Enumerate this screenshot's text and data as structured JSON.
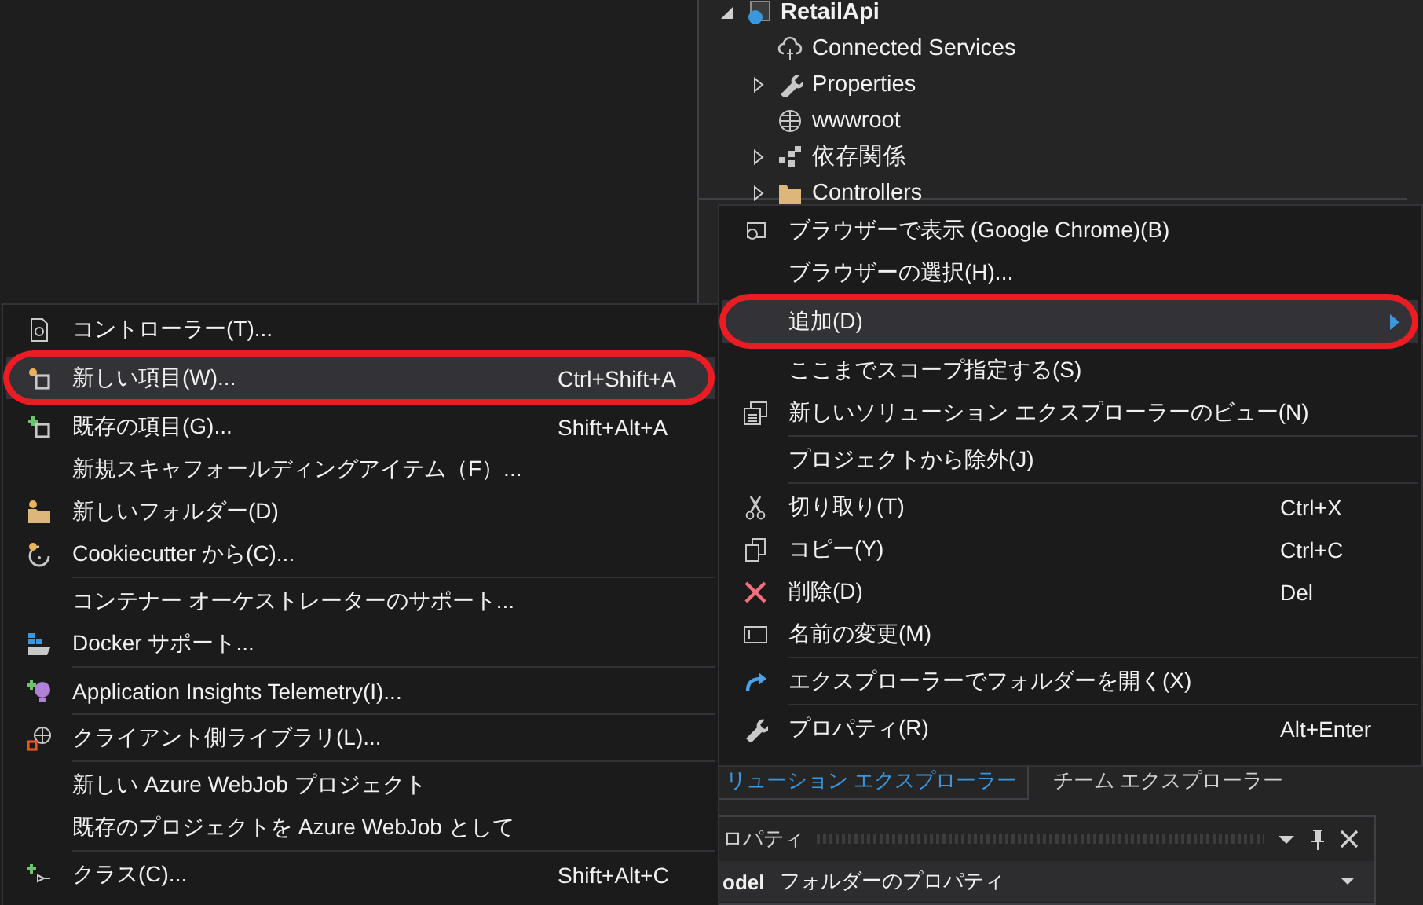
{
  "solution_tree": [
    {
      "label": "RetailApi",
      "kind": "project",
      "expanded": true,
      "children": [
        {
          "label": "Connected Services",
          "kind": "cloud"
        },
        {
          "label": "Properties",
          "kind": "wrench",
          "expanded": false
        },
        {
          "label": "wwwroot",
          "kind": "globe"
        },
        {
          "label": "依存関係",
          "kind": "deps",
          "expanded": false
        },
        {
          "label": "Controllers",
          "kind": "folder",
          "expanded": false
        }
      ]
    }
  ],
  "context_menu": {
    "groups": [
      [
        {
          "label": "ブラウザーで表示 (Google Chrome)(B)",
          "kind": "browser",
          "selected": false,
          "circled": false,
          "submenu": false
        },
        {
          "label": "ブラウザーの選択(H)...",
          "selected": false,
          "circled": false,
          "submenu": false
        },
        {
          "label": "追加(D)",
          "selected": true,
          "circled": true,
          "submenu": true
        },
        {
          "label": "ここまでスコープ指定する(S)",
          "selected": false,
          "circled": false,
          "submenu": false
        },
        {
          "label": "新しいソリューション エクスプローラーのビュー(N)",
          "kind": "newview",
          "selected": false,
          "circled": false,
          "submenu": false
        }
      ],
      [
        {
          "label": "プロジェクトから除外(J)",
          "selected": false,
          "circled": false,
          "submenu": false
        }
      ],
      [
        {
          "label": "切り取り(T)",
          "kind": "cut",
          "shortcut": "Ctrl+X",
          "selected": false,
          "circled": false,
          "submenu": false
        },
        {
          "label": "コピー(Y)",
          "kind": "copy",
          "shortcut": "Ctrl+C",
          "selected": false,
          "circled": false,
          "submenu": false
        },
        {
          "label": "削除(D)",
          "kind": "delete",
          "shortcut": "Del",
          "selected": false,
          "circled": false,
          "submenu": false
        },
        {
          "label": "名前の変更(M)",
          "kind": "rename",
          "selected": false,
          "circled": false,
          "submenu": false
        }
      ],
      [
        {
          "label": "エクスプローラーでフォルダーを開く(X)",
          "kind": "openfolder",
          "selected": false,
          "circled": false,
          "submenu": false
        }
      ],
      [
        {
          "label": "プロパティ(R)",
          "kind": "properties",
          "shortcut": "Alt+Enter",
          "selected": false,
          "circled": false,
          "submenu": false
        }
      ]
    ]
  },
  "add_submenu": {
    "groups": [
      [
        {
          "label": "コントローラー(T)...",
          "kind": "controller",
          "selected": false,
          "circled": false
        },
        {
          "label": "新しい項目(W)...",
          "kind": "newitem",
          "shortcut": "Ctrl+Shift+A",
          "selected": true,
          "circled": true
        },
        {
          "label": "既存の項目(G)...",
          "kind": "existingitem",
          "shortcut": "Shift+Alt+A",
          "selected": false,
          "circled": false
        },
        {
          "label": "新規スキャフォールディングアイテム（F）...",
          "selected": false,
          "circled": false
        },
        {
          "label": "新しいフォルダー(D)",
          "kind": "newfolder",
          "selected": false,
          "circled": false
        },
        {
          "label": "Cookiecutter から(C)...",
          "kind": "cookie",
          "selected": false,
          "circled": false
        }
      ],
      [
        {
          "label": "コンテナー オーケストレーターのサポート...",
          "selected": false,
          "circled": false
        },
        {
          "label": "Docker サポート...",
          "kind": "docker",
          "selected": false,
          "circled": false
        }
      ],
      [
        {
          "label": "Application Insights Telemetry(I)...",
          "kind": "insights",
          "selected": false,
          "circled": false
        }
      ],
      [
        {
          "label": "クライアント側ライブラリ(L)...",
          "kind": "library",
          "selected": false,
          "circled": false
        }
      ],
      [
        {
          "label": "新しい Azure WebJob プロジェクト",
          "selected": false,
          "circled": false
        },
        {
          "label": "既存のプロジェクトを Azure WebJob として",
          "selected": false,
          "circled": false
        }
      ],
      [
        {
          "label": "クラス(C)...",
          "kind": "class",
          "shortcut": "Shift+Alt+C",
          "selected": false,
          "circled": false
        }
      ]
    ]
  },
  "tool_tabs": [
    {
      "label": "リューション エクスプローラー",
      "selected": true
    },
    {
      "label": "チーム エクスプローラー",
      "selected": false
    }
  ],
  "properties_panel": {
    "title": "ロパティ",
    "object_name": "odel",
    "object_type": "フォルダーのプロパティ"
  }
}
